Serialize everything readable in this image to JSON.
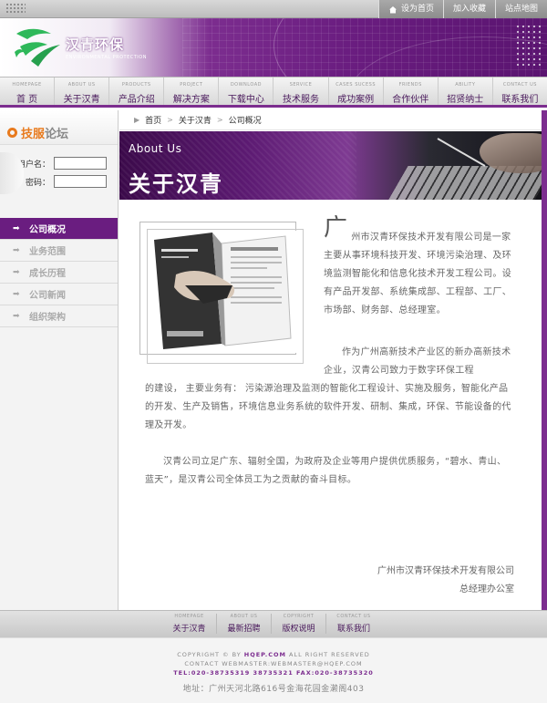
{
  "top_links": [
    {
      "label": "设为首页",
      "icon": "home-icon"
    },
    {
      "label": "加入收藏",
      "icon": ""
    },
    {
      "label": "站点地图",
      "icon": ""
    }
  ],
  "logo": {
    "cn": "汉青环保",
    "en": "ENVIRONMENTAL PROTECTION"
  },
  "nav": [
    {
      "en": "HOMEPAGE",
      "cn": "首    页"
    },
    {
      "en": "ABOUT US",
      "cn": "关于汉青"
    },
    {
      "en": "PRODUCTS",
      "cn": "产品介绍"
    },
    {
      "en": "PROJECT",
      "cn": "解决方案"
    },
    {
      "en": "DOWNLOAD",
      "cn": "下载中心"
    },
    {
      "en": "SERVICE",
      "cn": "技术服务"
    },
    {
      "en": "CASES SUCESS",
      "cn": "成功案例"
    },
    {
      "en": "FRIENDS",
      "cn": "合作伙伴"
    },
    {
      "en": "ABILITY",
      "cn": "招贤纳士"
    },
    {
      "en": "CONTACT US",
      "cn": "联系我们"
    }
  ],
  "sidebar": {
    "forum_title_a": "技服",
    "forum_title_b": "论坛",
    "username_label": "用户名：",
    "password_label": "密码：",
    "username_value": "",
    "password_value": "",
    "menu": [
      {
        "label": "公司概况",
        "active": true
      },
      {
        "label": "业务范围",
        "active": false
      },
      {
        "label": "成长历程",
        "active": false
      },
      {
        "label": "公司新闻",
        "active": false
      },
      {
        "label": "组织架构",
        "active": false
      }
    ]
  },
  "breadcrumb": {
    "home": "首页",
    "section": "关于汉青",
    "current": "公司概况"
  },
  "hero": {
    "en": "About Us",
    "cn": "关于汉青"
  },
  "article": {
    "big_char": "广",
    "p1": "州市汉青环保技术开发有限公司是一家主要从事环境科技开发、环境污染治理、及环境监测智能化和信息化技术开发工程公司。设有产品开发部、系统集成部、工程部、工厂、市场部、财务部、总经理室。",
    "p2_top": "作为广州高新技术产业区的新办高新技术企业，汉青公司致力于数字环保工程",
    "p2_rest": "的建设， 主要业务有： 污染源治理及监测的智能化工程设计、实施及服务，智能化产品的开发、生产及销售，环境信息业务系统的软件开发、研制、集成，环保、节能设备的代理及开发。",
    "p3": "汉青公司立足广东、辐射全国，为政府及企业等用户提供优质服务，“碧水、青山、蓝天”，是汉青公司全体员工为之贡献的奋斗目标。",
    "sign_company": "广州市汉青环保技术开发有限公司",
    "sign_office": "总经理办公室"
  },
  "footer_nav": [
    {
      "en": "HOMEPAGE",
      "cn": "关于汉青"
    },
    {
      "en": "ABOUT US",
      "cn": "最新招聘"
    },
    {
      "en": "COPYRIGHT",
      "cn": "版权说明"
    },
    {
      "en": "CONTACT US",
      "cn": "联系我们"
    }
  ],
  "footer": {
    "copyright_prefix": "COPYRIGHT © BY ",
    "copyright_site": "HQEP.COM",
    "copyright_suffix": " ALL RIGHT RESERVED",
    "contact": "CONTACT WEBMASTER:WEBMASTER@HQEP.COM",
    "tel": "TEL:020-38735319 38735321   FAX:020-38735320",
    "address": "地址：广州天河北路616号金海花园金濑阁403"
  },
  "colors": {
    "brand_purple": "#7c2d8f",
    "accent_orange": "#e87a1d",
    "logo_green": "#2fb85a"
  }
}
